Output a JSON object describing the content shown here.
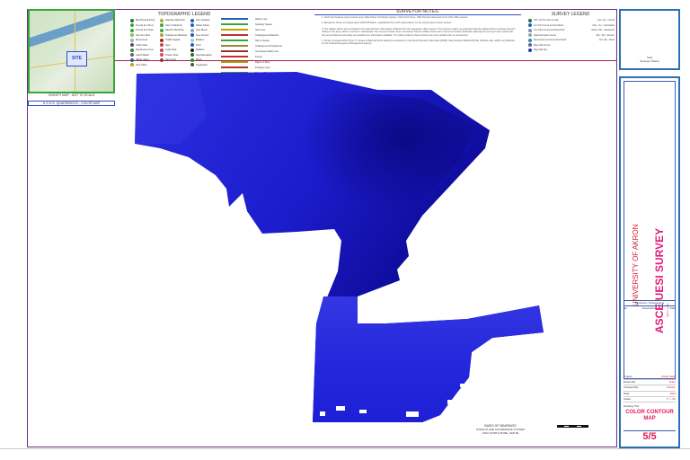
{
  "vicinity": {
    "site_label": "SITE",
    "caption": "VICINITY MAP - NOT TO SCALE",
    "caption2": "U.S.G.S. QUADRANGLE - COLOR MAP"
  },
  "topographic_legend": {
    "title": "TOPOGRAPHIC LEGEND",
    "columns": [
      [
        {
          "label": "Benchmark Point",
          "color": "#2e6b2e"
        },
        {
          "label": "Found Iron Rod",
          "color": "#3aa53a"
        },
        {
          "label": "Found Iron Pipe",
          "color": "#3aa53a"
        },
        {
          "label": "Set Iron Rod",
          "color": "#8bc34a"
        },
        {
          "label": "Monument",
          "color": "#aaaaaa"
        },
        {
          "label": "Utility Pole",
          "color": "#555555"
        },
        {
          "label": "Deciduous Tree",
          "color": "#2e8b2e"
        },
        {
          "label": "Catch Basin",
          "color": "#666666"
        },
        {
          "label": "Water Valve",
          "color": "#1f5fb5"
        },
        {
          "label": "Gas Valve",
          "color": "#c9a000"
        }
      ],
      [
        {
          "label": "Sanitary Manhole",
          "color": "#a0b030"
        },
        {
          "label": "Storm Manhole",
          "color": "#3aa53a"
        },
        {
          "label": "Electric Manhole",
          "color": "#3aa53a"
        },
        {
          "label": "Telephone Manhole",
          "color": "#b0a040"
        },
        {
          "label": "Traffic Signal",
          "color": "#a02020"
        },
        {
          "label": "Sign",
          "color": "#d04040"
        },
        {
          "label": "Light Pole",
          "color": "#c04060"
        },
        {
          "label": "Power Pole",
          "color": "#d05050"
        },
        {
          "label": "Sign Post",
          "color": "#9a3030"
        }
      ],
      [
        {
          "label": "Fire Hydrant",
          "color": "#2060c0"
        },
        {
          "label": "Water Meter",
          "color": "#2060c0"
        },
        {
          "label": "Gas Meter",
          "color": "#90a0b0"
        },
        {
          "label": "Guy Anchor",
          "color": "#1f5fb5"
        },
        {
          "label": "Bollard",
          "color": "#c0c0c0"
        },
        {
          "label": "Post",
          "color": "#2060c0"
        },
        {
          "label": "Mailbox",
          "color": "#1f1f1f"
        },
        {
          "label": "Spot Elevation",
          "color": "#2e6b2e"
        },
        {
          "label": "Bush",
          "color": "#2e8b2e"
        },
        {
          "label": "Vegetation",
          "color": "#2e6b2e"
        }
      ]
    ],
    "lines": [
      {
        "label": "Water Line",
        "color": "#1f5fb5"
      },
      {
        "label": "Sanitary Sewer",
        "color": "#3aa53a"
      },
      {
        "label": "Gas Line",
        "color": "#c9a000"
      },
      {
        "label": "Underground Electric",
        "color": "#c03030"
      },
      {
        "label": "Storm Sewer",
        "color": "#3aa53a"
      },
      {
        "label": "Underground Telephone",
        "color": "#9a8a30"
      },
      {
        "label": "Overhead Utility Line",
        "color": "#9a3030"
      },
      {
        "label": "Fence",
        "color": "#c03030"
      },
      {
        "label": "Right-of-Way",
        "color": "#a0a000"
      },
      {
        "label": "Property Line",
        "color": "#c03030"
      },
      {
        "label": "Edge of Pavement",
        "color": "#3aa53a"
      },
      {
        "label": "Tree Line",
        "color": "#3aa53a"
      }
    ]
  },
  "survey_notes": {
    "title": "SURVEYOR NOTES:",
    "notes": [
      "1.   North and bearing system based upon State Plane Coordinate System, Ohio North Zone, NAD 83 and referenced to the Ohio VRS network.",
      "2.   Elevations shown are based upon NAVD 88 datum, established from GPS observations on the control points shown hereon.",
      "3.   The utilities shown are as located in the field and from information obtained from the respective utility owners. The surveyor makes no guarantee that the utilities shown comprise all such utilities in the area, either in service or abandoned. The surveyor further does not warrant that the utilities shown are in the exact location indicated, although the surveyor does certify that they are located as accurately as possible from information available. The utility locations shown hereon are to be verified prior to construction.",
      "4.   Parcel is located within Zone \"X\" (areas of Minimal Flood Hazard) as depicted on the Flood Insurance Rate Map (FIRM), Map Number 39153C0XXXE, effective date, 2018, as published by the Federal Emergency Management Agency."
    ]
  },
  "survey_legend": {
    "title": "SURVEY LEGEND",
    "items": [
      {
        "label": "5/8\" Iron Pin Set w/ Cap",
        "color": "#2e6b2e",
        "abbr": "Fnd. (F) - Found"
      },
      {
        "label": "Iron Pin Found as Described",
        "color": "#2060c0",
        "abbr": "Calc. (C) - Calculated"
      },
      {
        "label": "Iron Pipe Found as Described",
        "color": "#7090b0",
        "abbr": "Meas. (M) - Measured"
      },
      {
        "label": "Railroad Spike Found",
        "color": "#9aa0a8",
        "abbr": "Rec. (R) - Record"
      },
      {
        "label": "Monument Found as Described",
        "color": "#2090b0",
        "abbr": "Dd. (D) - Deed"
      },
      {
        "label": "Mag Nail Found",
        "color": "#6060a0",
        "abbr": ""
      },
      {
        "label": "Mag Nail Set",
        "color": "#1f3f9f",
        "abbr": ""
      }
    ]
  },
  "title_block": {
    "top_caption": "Seal",
    "top_caption2": "Surveyor Stamp",
    "university": "UNIVERSITY OF AKRON",
    "project": "ASCE UESI SURVEY",
    "project_sub": "Akron, Ohio",
    "revisions_header": "Revisions / Submissions",
    "revision_cols": [
      "No.",
      "Description",
      "Date"
    ],
    "data_rows": [
      {
        "label": "Project:",
        "value": "ASCE UESI"
      },
      {
        "label": "Drawn By:",
        "value": "Team"
      },
      {
        "label": "Checked By:",
        "value": "Advisor"
      },
      {
        "label": "Date:",
        "value": "2023"
      },
      {
        "label": "Scale:",
        "value": "1\" = 30'"
      }
    ],
    "drawing_title_label": "Drawing Title",
    "drawing_title": "COLOR CONTOUR MAP",
    "sheet_number": "5/5"
  },
  "bearing_note": {
    "heading": "BASIS OF BEARINGS",
    "line1": "STATE PLANE COORDINATE SYSTEM",
    "line2": "OHIO NORTH ZONE, NAD 83"
  },
  "contour_colors": {
    "light": "#4d4fe6",
    "mid": "#2b2fe0",
    "dark": "#1410b8",
    "darkest": "#0b0a90"
  }
}
